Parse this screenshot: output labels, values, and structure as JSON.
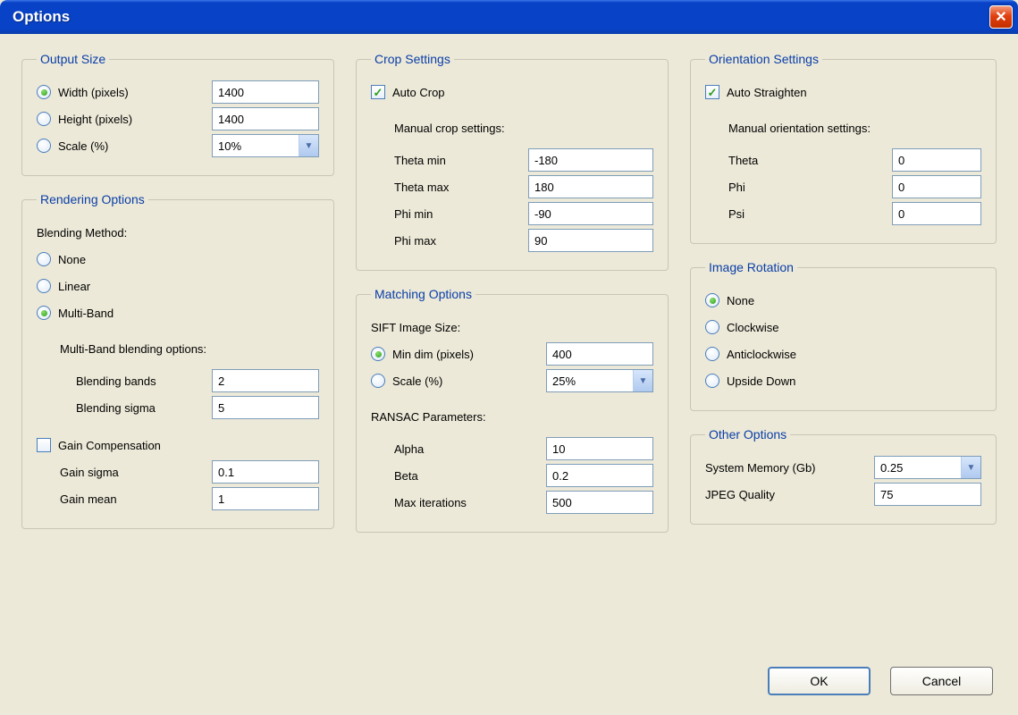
{
  "window": {
    "title": "Options"
  },
  "outputSize": {
    "legend": "Output Size",
    "widthLabel": "Width (pixels)",
    "heightLabel": "Height (pixels)",
    "scaleLabel": "Scale (%)",
    "widthValue": "1400",
    "heightValue": "1400",
    "scaleValue": "10%"
  },
  "rendering": {
    "legend": "Rendering Options",
    "blendingMethodLabel": "Blending Method:",
    "none": "None",
    "linear": "Linear",
    "multiband": "Multi-Band",
    "mbOptionsLabel": "Multi-Band blending options:",
    "blendingBandsLabel": "Blending bands",
    "blendingBandsValue": "2",
    "blendingSigmaLabel": "Blending sigma",
    "blendingSigmaValue": "5",
    "gainCompLabel": "Gain Compensation",
    "gainSigmaLabel": "Gain sigma",
    "gainSigmaValue": "0.1",
    "gainMeanLabel": "Gain mean",
    "gainMeanValue": "1"
  },
  "crop": {
    "legend": "Crop Settings",
    "autoCropLabel": "Auto Crop",
    "manualLabel": "Manual crop settings:",
    "thetaMinLabel": "Theta min",
    "thetaMinValue": "-180",
    "thetaMaxLabel": "Theta max",
    "thetaMaxValue": "180",
    "phiMinLabel": "Phi min",
    "phiMinValue": "-90",
    "phiMaxLabel": "Phi max",
    "phiMaxValue": "90"
  },
  "matching": {
    "legend": "Matching Options",
    "siftLabel": "SIFT Image Size:",
    "minDimLabel": "Min dim (pixels)",
    "minDimValue": "400",
    "scaleLabel": "Scale (%)",
    "scaleValue": "25%",
    "ransacLabel": "RANSAC Parameters:",
    "alphaLabel": "Alpha",
    "alphaValue": "10",
    "betaLabel": "Beta",
    "betaValue": "0.2",
    "maxIterLabel": "Max iterations",
    "maxIterValue": "500"
  },
  "orientation": {
    "legend": "Orientation Settings",
    "autoStraightenLabel": "Auto Straighten",
    "manualLabel": "Manual orientation settings:",
    "thetaLabel": "Theta",
    "thetaValue": "0",
    "phiLabel": "Phi",
    "phiValue": "0",
    "psiLabel": "Psi",
    "psiValue": "0"
  },
  "rotation": {
    "legend": "Image Rotation",
    "none": "None",
    "clockwise": "Clockwise",
    "anticlockwise": "Anticlockwise",
    "upsideDown": "Upside Down"
  },
  "other": {
    "legend": "Other Options",
    "sysMemLabel": "System Memory (Gb)",
    "sysMemValue": "0.25",
    "jpegLabel": "JPEG Quality",
    "jpegValue": "75"
  },
  "buttons": {
    "ok": "OK",
    "cancel": "Cancel"
  }
}
